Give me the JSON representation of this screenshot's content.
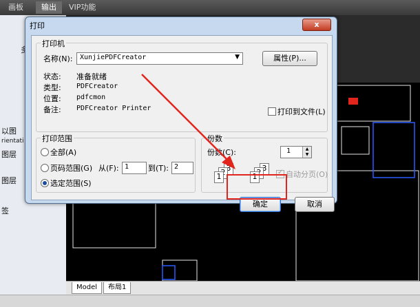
{
  "app": {
    "ribbon_tabs": [
      "画板",
      "输出",
      "VIP功能"
    ],
    "active_tab_index": 1,
    "left_panel": [
      "多",
      "以图",
      "rientati",
      "图层",
      "图层",
      "签"
    ],
    "bottom_tabs": [
      "Model",
      "布局1"
    ]
  },
  "dialog": {
    "title": "打印",
    "close_label": "x",
    "printer": {
      "legend": "打印机",
      "name_label": "名称(N):",
      "name_value": "XunjiePDFCreator",
      "properties_label": "属性(P)...",
      "status_label": "状态:",
      "status_value": "准备就绪",
      "type_label": "类型:",
      "type_value": "PDFCreator",
      "where_label": "位置:",
      "where_value": "pdfcmon",
      "comment_label": "备注:",
      "comment_value": "PDFCreator Printer",
      "print_to_file_label": "打印到文件(L)",
      "print_to_file_checked": false
    },
    "range": {
      "legend": "打印范围",
      "all_label": "全部(A)",
      "pages_label": "页码范围(G)",
      "from_label": "从(F):",
      "from_value": "1",
      "to_label": "到(T):",
      "to_value": "2",
      "selection_label": "选定范围(S)",
      "selected": "selection"
    },
    "copies": {
      "legend": "份数",
      "count_label": "份数(C):",
      "count_value": "1",
      "collate_label": "自动分页(O)",
      "collate_checked": true
    },
    "ok_label": "确定",
    "cancel_label": "取消"
  },
  "colors": {
    "annotation": "#e1241c",
    "dialog_frame": "#c6d9ee"
  }
}
